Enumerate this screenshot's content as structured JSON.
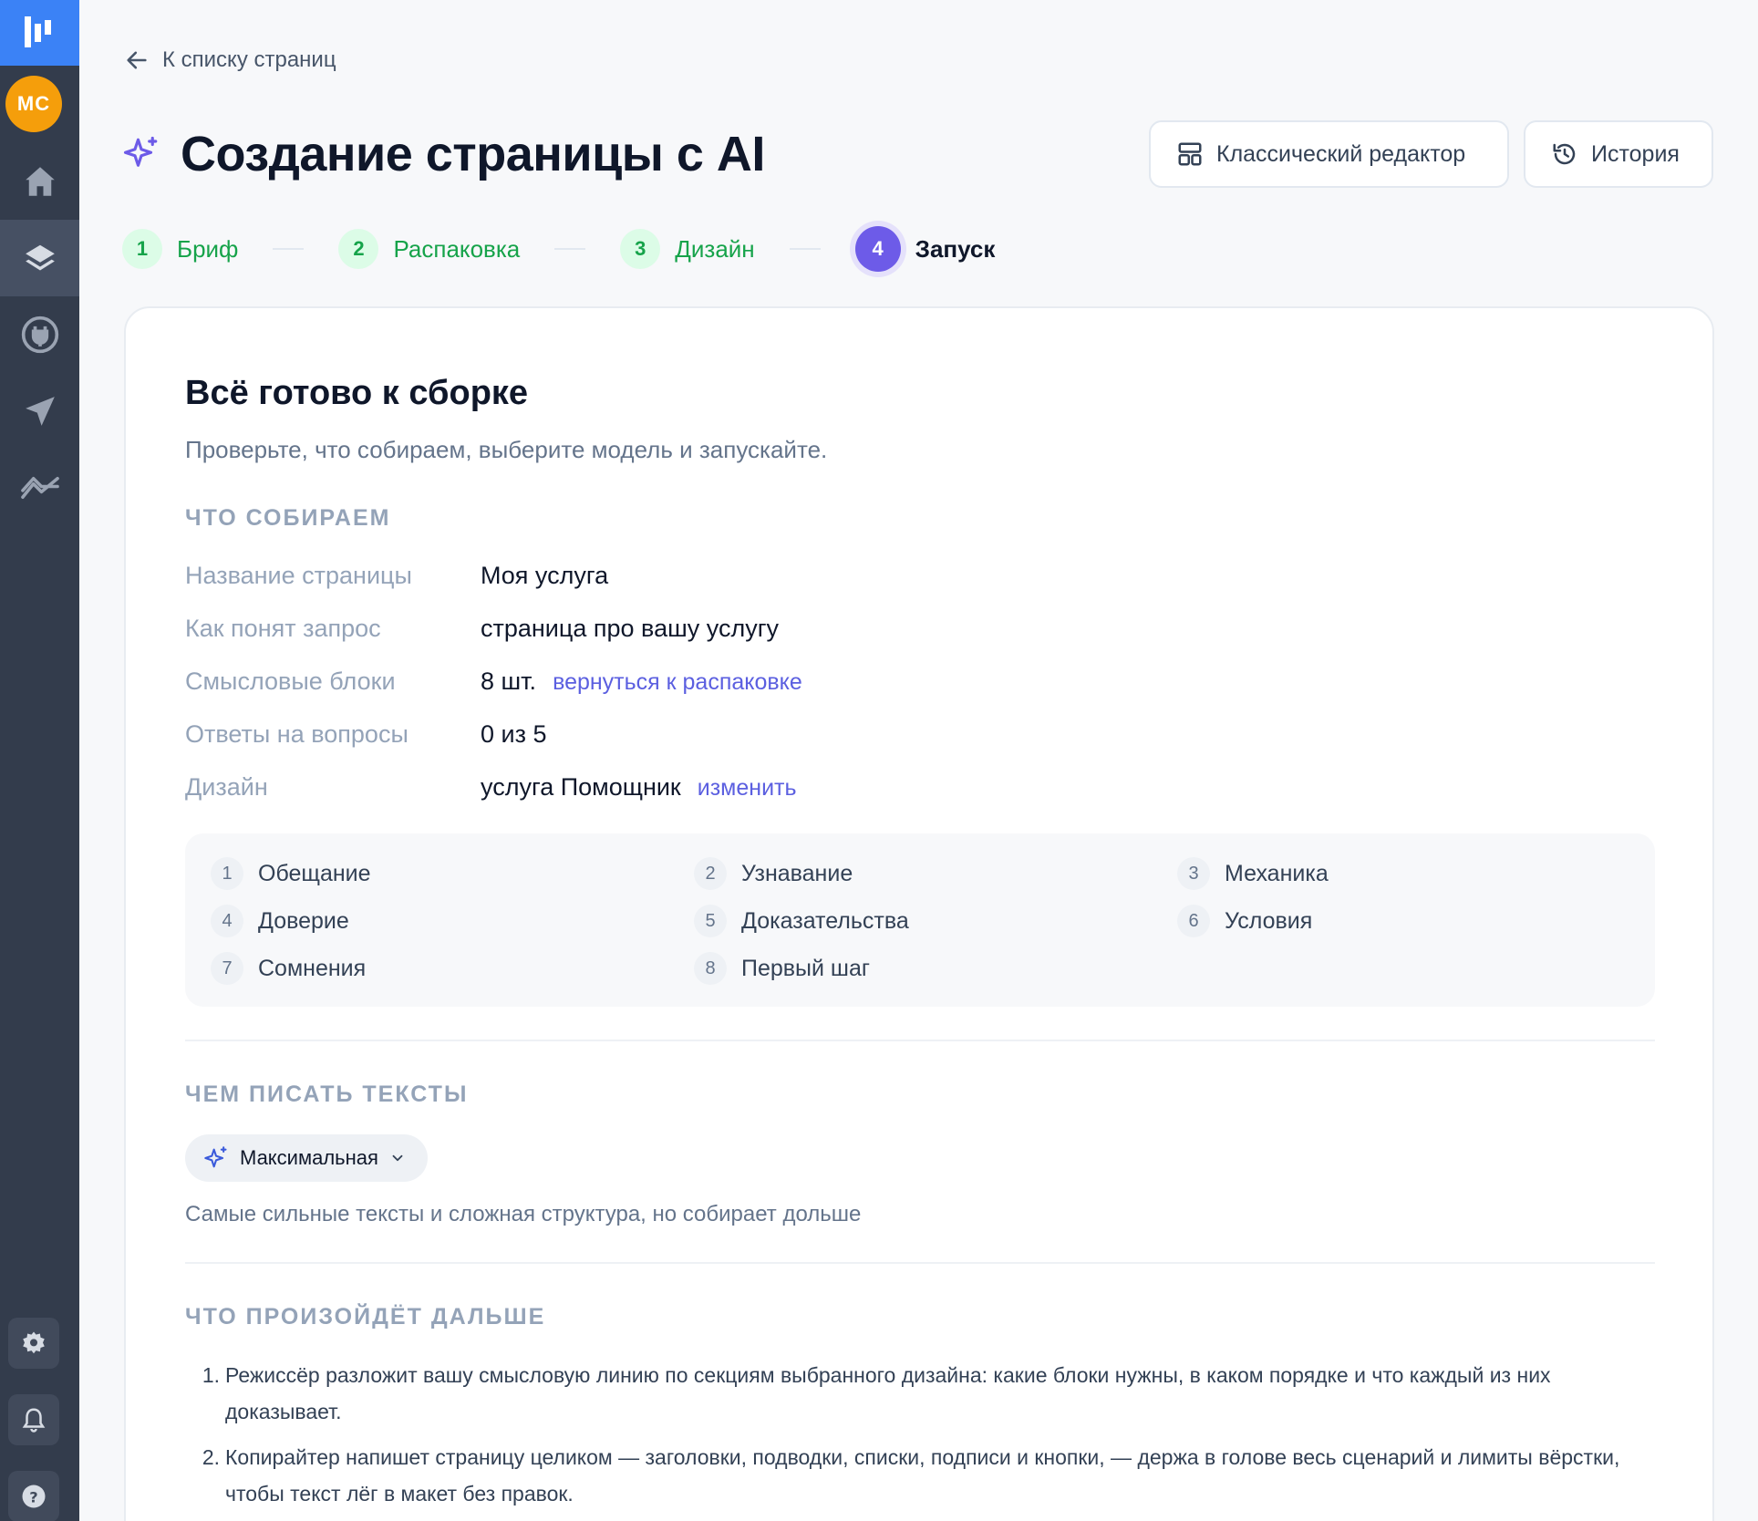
{
  "sidebar": {
    "avatar_initials": "МС",
    "items": [
      {
        "icon": "home-icon"
      },
      {
        "icon": "layers-icon",
        "active": true
      },
      {
        "icon": "plug-icon"
      },
      {
        "icon": "send-icon"
      },
      {
        "icon": "analytics-icon"
      }
    ],
    "bottom": [
      {
        "icon": "gear-icon"
      },
      {
        "icon": "bell-icon"
      },
      {
        "icon": "help-icon"
      }
    ]
  },
  "nav": {
    "back_label": "К списку страниц"
  },
  "header": {
    "title": "Создание страницы с AI",
    "classic_editor_label": "Классический редактор",
    "history_label": "История"
  },
  "stepper": [
    {
      "num": "1",
      "label": "Бриф"
    },
    {
      "num": "2",
      "label": "Распаковка"
    },
    {
      "num": "3",
      "label": "Дизайн"
    },
    {
      "num": "4",
      "label": "Запуск"
    }
  ],
  "card": {
    "title": "Всё готово к сборке",
    "subtitle": "Проверьте, что собираем, выберите модель и запускайте.",
    "section_what": "ЧТО СОБИРАЕМ",
    "rows": {
      "page_name": {
        "label": "Название страницы",
        "value": "Моя услуга"
      },
      "request": {
        "label": "Как понят запрос",
        "value": "страница про вашу услугу"
      },
      "blocks": {
        "label": "Смысловые блоки",
        "value": "8 шт.",
        "link": "вернуться к распаковке"
      },
      "answers": {
        "label": "Ответы на вопросы",
        "value": "0 из 5"
      },
      "design": {
        "label": "Дизайн",
        "value": "услуга Помощник",
        "link": "изменить"
      }
    },
    "blocks_list": [
      {
        "n": "1",
        "label": "Обещание"
      },
      {
        "n": "2",
        "label": "Узнавание"
      },
      {
        "n": "3",
        "label": "Механика"
      },
      {
        "n": "4",
        "label": "Доверие"
      },
      {
        "n": "5",
        "label": "Доказательства"
      },
      {
        "n": "6",
        "label": "Условия"
      },
      {
        "n": "7",
        "label": "Сомнения"
      },
      {
        "n": "8",
        "label": "Первый шаг"
      }
    ],
    "section_model": "ЧЕМ ПИСАТЬ ТЕКСТЫ",
    "model": {
      "selected": "Максимальная",
      "description": "Самые сильные тексты и сложная структура, но собирает дольше"
    },
    "section_next": "ЧТО ПРОИЗОЙДЁТ ДАЛЬШЕ",
    "next_steps": [
      {
        "n": "1.",
        "text": "Режиссёр разложит вашу смысловую линию по секциям выбранного дизайна: какие блоки нужны, в каком порядке и что каждый из них доказывает."
      },
      {
        "n": "2.",
        "text": "Копирайтер напишет страницу целиком — заголовки, подводки, списки, подписи и кнопки, — держа в голове весь сценарий и лимиты вёрстки, чтобы текст лёг в макет без правок."
      }
    ]
  },
  "colors": {
    "sidebar": "#333c4c",
    "logo": "#3b82f6",
    "avatar": "#f59e0b",
    "accent": "#6d5be8",
    "done": "#16a34a",
    "link": "#5b5fe0"
  }
}
